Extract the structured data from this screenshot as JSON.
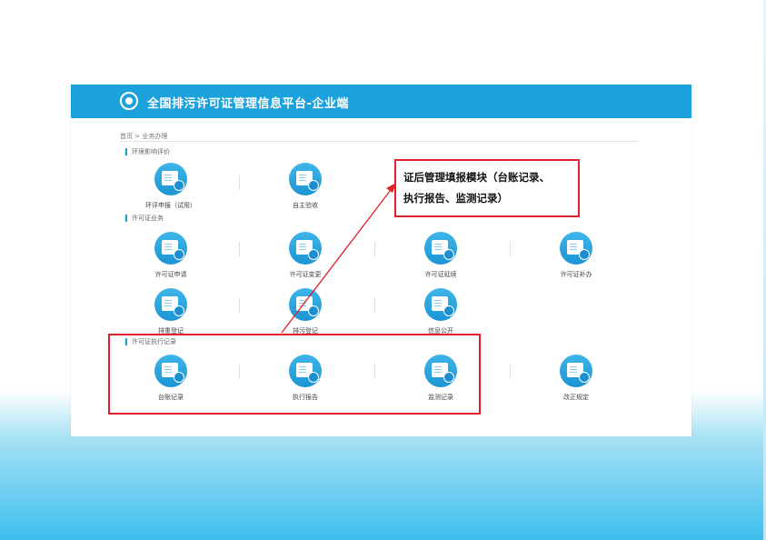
{
  "header": {
    "title": "全国排污许可证管理信息平台-企业端"
  },
  "breadcrumb": "首页 > 业务办理",
  "sections": {
    "eia": "环境影响评价",
    "permit": "许可证业务",
    "execution": "许可证执行记录"
  },
  "tiles": {
    "eia_report": "环评申报（试用）",
    "self_acceptance": "自主验收",
    "permit_apply": "许可证申请",
    "permit_change": "许可证变更",
    "permit_renew": "许可证延续",
    "permit_reissue": "许可证补办",
    "reregister": "排重登记",
    "pollution_register": "排污登记",
    "info_disclosure": "信息公开",
    "ledger": "台账记录",
    "execution_report": "执行报告",
    "monitoring": "监测记录",
    "rectification": "改正规定"
  },
  "callout": {
    "line1": "证后管理填报模块（台账记录、",
    "line2": "执行报告、监测记录）"
  },
  "colors": {
    "brand": "#1ba1dc",
    "highlight": "#e0202a"
  }
}
